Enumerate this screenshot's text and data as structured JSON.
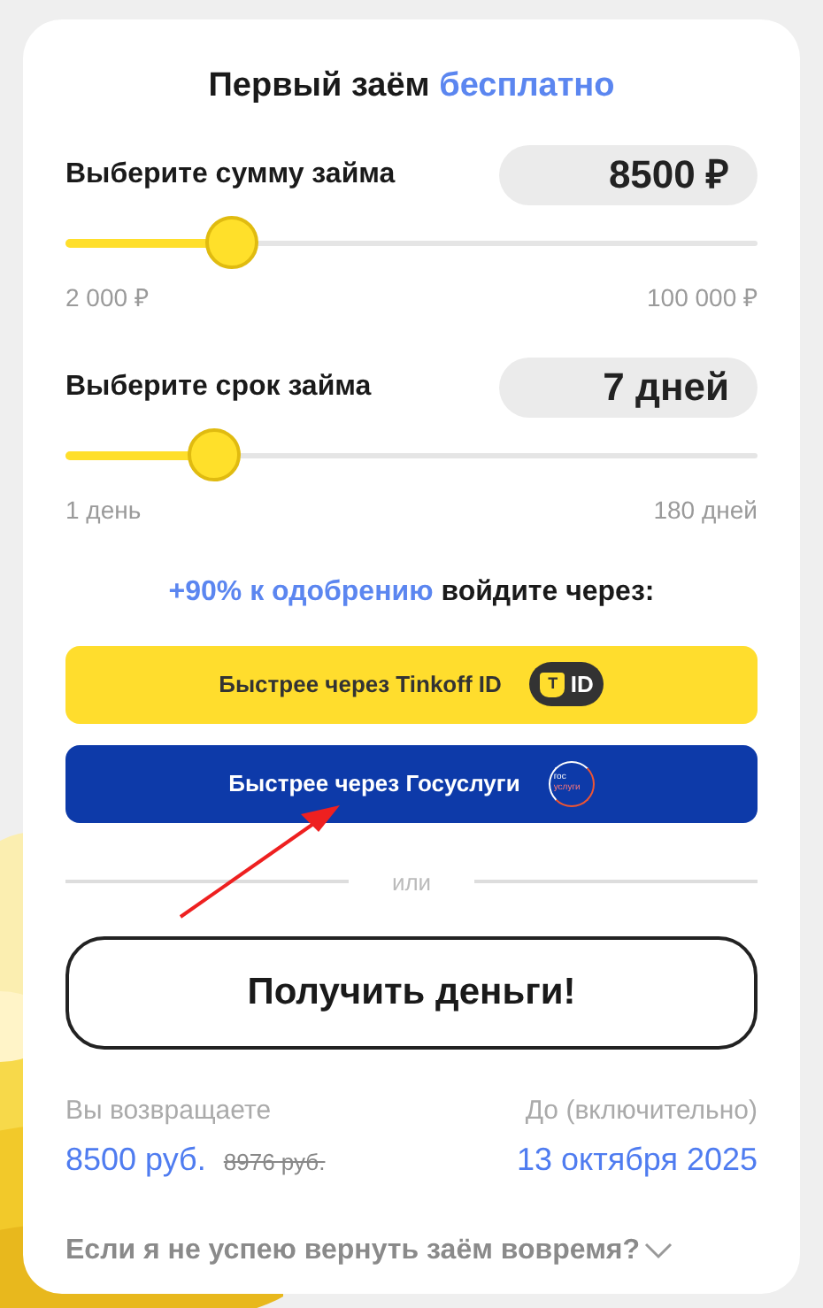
{
  "title": {
    "text": "Первый заём",
    "accent": "бесплатно"
  },
  "sliders": [
    {
      "label": "Выберите сумму займа",
      "value": "8500 ₽",
      "level": 0.24,
      "min": "2 000 ₽",
      "max": "100 000 ₽"
    },
    {
      "label": "Выберите срок займа",
      "value": "7 дней",
      "level": 0.214,
      "min": "1 день",
      "max": "180 дней"
    }
  ],
  "login_prompt": {
    "accent": "+90% к одобрению",
    "text": "войдите через:"
  },
  "login_buttons": [
    {
      "kind": "tinkoff",
      "label": "Быстрее через Tinkoff ID",
      "badge_letter": "T",
      "badge_text": "ID"
    },
    {
      "kind": "gosuslugi",
      "label": "Быстрее через Госуслуги",
      "logo_lines": [
        "гос",
        "услуги"
      ]
    }
  ],
  "divider": "или",
  "submit": "Получить деньги!",
  "repay": {
    "label": "Вы возвращаете",
    "amount": "8500 руб.",
    "old_amount": "8976 руб."
  },
  "due": {
    "label": "До (включительно)",
    "date": "13 октября 2025"
  },
  "faq": {
    "question": "Если я не успею вернуть заём вовремя?",
    "expanded": false
  }
}
